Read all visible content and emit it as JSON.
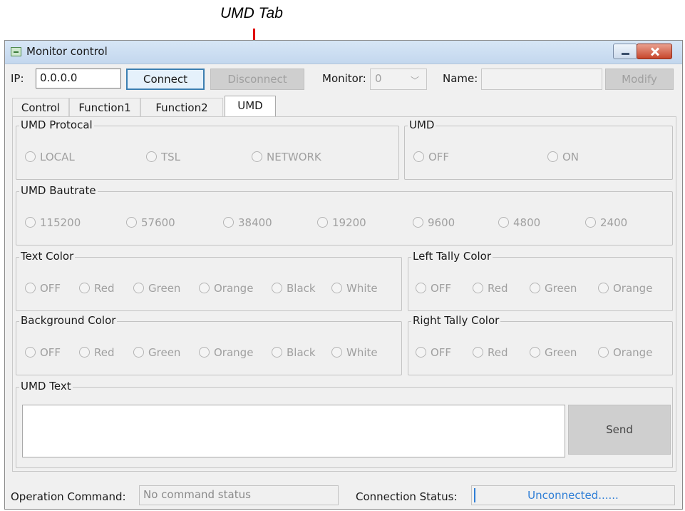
{
  "annotation": {
    "label": "UMD Tab",
    "color": "#e00000"
  },
  "window": {
    "title": "Monitor control",
    "icon": "app-icon"
  },
  "toolbar": {
    "ip_label": "IP:",
    "ip_value": "0.0.0.0",
    "connect_label": "Connect",
    "disconnect_label": "Disconnect",
    "monitor_label": "Monitor:",
    "monitor_value": "0",
    "name_label": "Name:",
    "name_value": "",
    "modify_label": "Modify"
  },
  "tabs": [
    {
      "label": "Control"
    },
    {
      "label": "Function1"
    },
    {
      "label": "Function2"
    },
    {
      "label": "UMD",
      "active": true
    }
  ],
  "groups": {
    "protocol": {
      "title": "UMD Protocal",
      "options": [
        "LOCAL",
        "TSL",
        "NETWORK"
      ]
    },
    "umd": {
      "title": "UMD",
      "options": [
        "OFF",
        "ON"
      ]
    },
    "baudrate": {
      "title": "UMD Bautrate",
      "options": [
        "115200",
        "57600",
        "38400",
        "19200",
        "9600",
        "4800",
        "2400"
      ]
    },
    "text_color": {
      "title": "Text Color",
      "options": [
        "OFF",
        "Red",
        "Green",
        "Orange",
        "Black",
        "White"
      ]
    },
    "left_tally": {
      "title": "Left Tally Color",
      "options": [
        "OFF",
        "Red",
        "Green",
        "Orange"
      ]
    },
    "background_color": {
      "title": "Background Color",
      "options": [
        "OFF",
        "Red",
        "Green",
        "Orange",
        "Black",
        "White"
      ]
    },
    "right_tally": {
      "title": "Right Tally Color",
      "options": [
        "OFF",
        "Red",
        "Green",
        "Orange"
      ]
    },
    "umd_text": {
      "title": "UMD Text",
      "value": "",
      "send_label": "Send"
    }
  },
  "statusbar": {
    "operation_label": "Operation Command:",
    "operation_value": "No command status",
    "connection_label": "Connection Status:",
    "connection_value": "Unconnected......",
    "connection_color": "#2e7ed6"
  }
}
